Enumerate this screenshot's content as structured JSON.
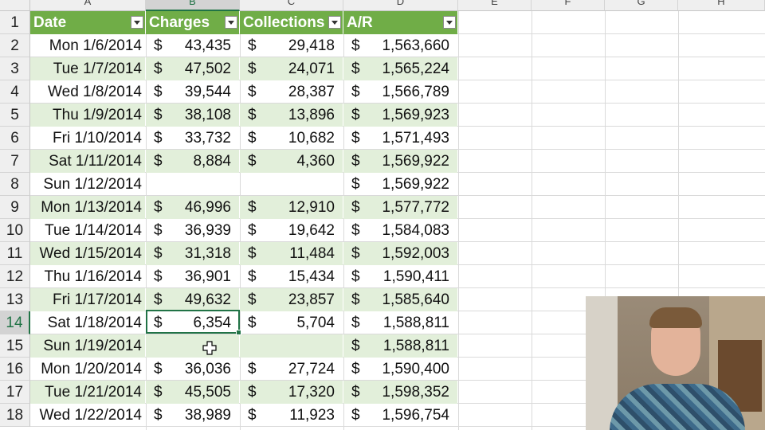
{
  "column_letters": [
    "A",
    "B",
    "C",
    "D",
    "E",
    "F",
    "G",
    "H"
  ],
  "row_numbers": [
    "1",
    "2",
    "3",
    "4",
    "5",
    "6",
    "7",
    "8",
    "9",
    "10",
    "11",
    "12",
    "13",
    "14",
    "15",
    "16",
    "17",
    "18"
  ],
  "table": {
    "headers": [
      "Date",
      "Charges",
      "Collections",
      "A/R"
    ],
    "currency_symbol": "$",
    "rows": [
      {
        "date": "Mon 1/6/2014",
        "charges": "43,435",
        "collections": "29,418",
        "ar": "1,563,660"
      },
      {
        "date": "Tue 1/7/2014",
        "charges": "47,502",
        "collections": "24,071",
        "ar": "1,565,224"
      },
      {
        "date": "Wed 1/8/2014",
        "charges": "39,544",
        "collections": "28,387",
        "ar": "1,566,789"
      },
      {
        "date": "Thu 1/9/2014",
        "charges": "38,108",
        "collections": "13,896",
        "ar": "1,569,923"
      },
      {
        "date": "Fri 1/10/2014",
        "charges": "33,732",
        "collections": "10,682",
        "ar": "1,571,493"
      },
      {
        "date": "Sat 1/11/2014",
        "charges": "8,884",
        "collections": "4,360",
        "ar": "1,569,922"
      },
      {
        "date": "Sun 1/12/2014",
        "charges": "",
        "collections": "",
        "ar": "1,569,922"
      },
      {
        "date": "Mon 1/13/2014",
        "charges": "46,996",
        "collections": "12,910",
        "ar": "1,577,772"
      },
      {
        "date": "Tue 1/14/2014",
        "charges": "36,939",
        "collections": "19,642",
        "ar": "1,584,083"
      },
      {
        "date": "Wed 1/15/2014",
        "charges": "31,318",
        "collections": "11,484",
        "ar": "1,592,003"
      },
      {
        "date": "Thu 1/16/2014",
        "charges": "36,901",
        "collections": "15,434",
        "ar": "1,590,411"
      },
      {
        "date": "Fri 1/17/2014",
        "charges": "49,632",
        "collections": "23,857",
        "ar": "1,585,640"
      },
      {
        "date": "Sat 1/18/2014",
        "charges": "6,354",
        "collections": "5,704",
        "ar": "1,588,811"
      },
      {
        "date": "Sun 1/19/2014",
        "charges": "",
        "collections": "",
        "ar": "1,588,811"
      },
      {
        "date": "Mon 1/20/2014",
        "charges": "36,036",
        "collections": "27,724",
        "ar": "1,590,400"
      },
      {
        "date": "Tue 1/21/2014",
        "charges": "45,505",
        "collections": "17,320",
        "ar": "1,598,352"
      },
      {
        "date": "Wed 1/22/2014",
        "charges": "38,989",
        "collections": "11,923",
        "ar": "1,596,754"
      }
    ]
  },
  "selection": {
    "active_column": "B",
    "active_row": "14"
  },
  "colors": {
    "header_green": "#70ad47",
    "band_green": "#e2efda",
    "selection_green": "#217346"
  },
  "icons": {
    "filter": "filter-dropdown-icon",
    "cursor": "cell-select-cursor-icon"
  }
}
